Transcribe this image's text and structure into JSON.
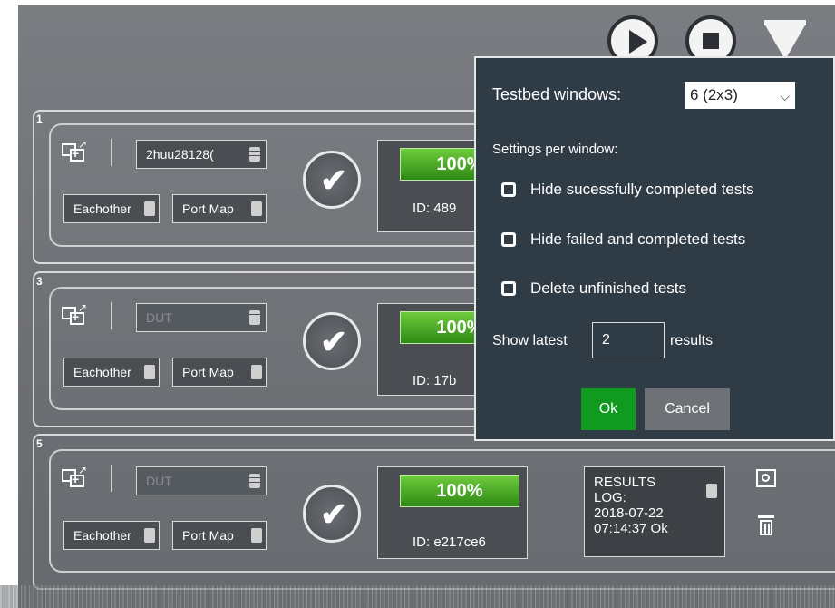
{
  "controls": {
    "play_icon": "play-icon",
    "stop_icon": "stop-icon",
    "filter_icon": "filter-icon"
  },
  "testbeds": [
    {
      "number": "1",
      "dut": "2huu28128(",
      "dut_muted": false,
      "eachother": "Eachother",
      "portmap": "Port Map",
      "progress": "100%",
      "progress_value": 100,
      "id": "ID:  489"
    },
    {
      "number": "3",
      "dut": "DUT",
      "dut_muted": true,
      "eachother": "Eachother",
      "portmap": "Port Map",
      "progress": "100%",
      "progress_value": 100,
      "id": "ID:  17b"
    },
    {
      "number": "5",
      "dut": "DUT",
      "dut_muted": true,
      "eachother": "Eachother",
      "portmap": "Port Map",
      "progress": "100%",
      "progress_value": 100,
      "id": "ID:  e217ce6",
      "log": [
        "RESULTS",
        "LOG:",
        "2018-07-22",
        "07:14:37 Ok"
      ]
    }
  ],
  "popup": {
    "windows_label": "Testbed windows:",
    "windows_value": "6 (2x3)",
    "settings_label": "Settings per window:",
    "options": [
      {
        "label": "Hide sucessfully completed tests",
        "checked": false
      },
      {
        "label": "Hide failed and completed tests",
        "checked": false
      },
      {
        "label": "Delete unfinished tests",
        "checked": false
      }
    ],
    "show_latest_label": "Show latest",
    "show_latest_value": "2",
    "results_label": "results",
    "ok_label": "Ok",
    "cancel_label": "Cancel"
  }
}
